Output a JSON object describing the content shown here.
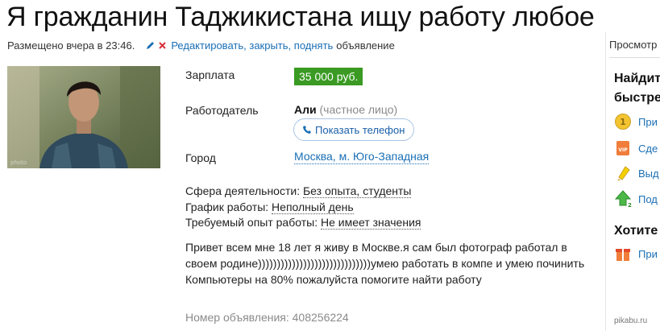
{
  "title": "Я гражданин Таджикистана ищу работу любое",
  "meta": {
    "posted": "Размещено вчера в 23:46.",
    "edit": "Редактировать,",
    "close": "закрыть,",
    "raise": "поднять",
    "tail": "объявление"
  },
  "details": {
    "salary_label": "Зарплата",
    "salary": "35 000 руб.",
    "employer_label": "Работодатель",
    "employer_name": "Али",
    "employer_kind": "(частное лицо)",
    "phone_button": "Показать телефон",
    "city_label": "Город",
    "city": "Москва, м. Юго-Западная"
  },
  "attributes": [
    {
      "label": "Сфера деятельности:",
      "value": "Без опыта, студенты"
    },
    {
      "label": "График работы:",
      "value": "Неполный день"
    },
    {
      "label": "Требуемый опыт работы:",
      "value": "Не имеет значения"
    }
  ],
  "description": "Привет всем мне 18 лет я живу в Москве.я сам был фотограф работал в своем родине))))))))))))))))))))))))))))))умею работать в компе и умею починить Компьютеры на 80% пожалуйста помогите найти работу",
  "ad_number": "Номер объявления: 408256224",
  "sidebar": {
    "top": "Просмотр",
    "heading1": "Найдит",
    "heading2": "быстре",
    "items": [
      {
        "icon": "coin-icon",
        "text": "При"
      },
      {
        "icon": "vip-icon",
        "text": "Сде"
      },
      {
        "icon": "marker-icon",
        "text": "Выд"
      },
      {
        "icon": "up-arrow-icon",
        "text": "Под"
      }
    ],
    "heading3": "Хотите",
    "items2": [
      {
        "icon": "gift-box-icon",
        "text": "При"
      }
    ]
  },
  "watermark": "pikabu.ru",
  "colors": {
    "link": "#1a6fb5",
    "salary_bg": "#3a9a23",
    "muted": "#8a8a8a"
  }
}
